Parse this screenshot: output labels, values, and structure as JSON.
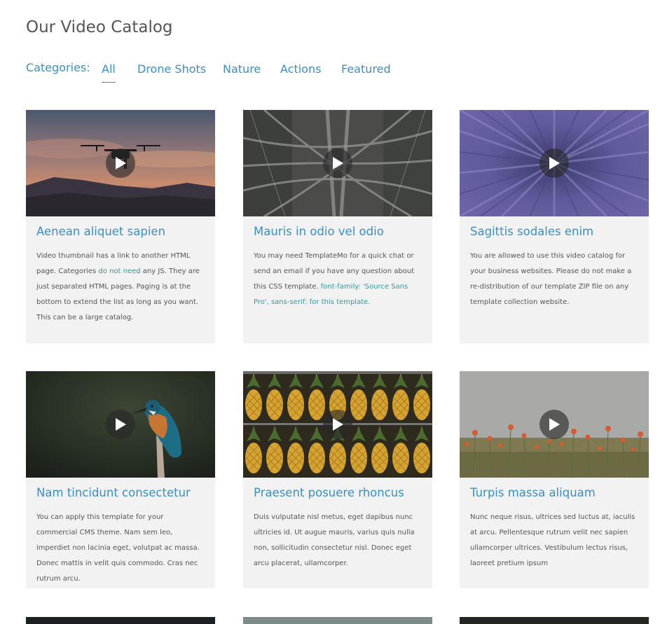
{
  "page": {
    "title": "Our Video Catalog"
  },
  "categories": {
    "label": "Categories:",
    "items": [
      {
        "label": "All",
        "active": true
      },
      {
        "label": "Drone Shots",
        "active": false
      },
      {
        "label": "Nature",
        "active": false
      },
      {
        "label": "Actions",
        "active": false
      },
      {
        "label": "Featured",
        "active": false
      }
    ]
  },
  "videos": [
    {
      "title": "Aenean aliquet sapien",
      "text_1": "Video thumbnail has a link to another HTML page. Categories ",
      "link": "do not need",
      "text_2": " any JS. They are just separated HTML pages. Paging is at the bottom to extend the list as long as you want. This can be a large catalog.",
      "thumbnail": "drone-at-sunset"
    },
    {
      "title": "Mauris in odio vel odio",
      "text_1": "You may need TemplateMo for a quick chat or send an email if you have any question about this CSS template. ",
      "link": "font-family: 'Source Sans Pro', sans-serif; for this template.",
      "text_2": "",
      "thumbnail": "highway-interchange"
    },
    {
      "title": "Sagittis sodales enim",
      "text_1": "You are allowed to use this video catalog for your business websites. Please do not make a re-distribution of our template ZIP file on any template collection website.",
      "link": "",
      "text_2": "",
      "thumbnail": "lavender-field"
    },
    {
      "title": "Nam tincidunt consectetur",
      "text_1": "You can apply this template for your commercial CMS theme. Nam sem leo, imperdiet non lacinia eget, volutpat ac massa. Donec mattis in velit quis commodo. Cras nec rutrum arcu.",
      "link": "",
      "text_2": "",
      "thumbnail": "kingfisher-bird"
    },
    {
      "title": "Praesent posuere rhoncus",
      "text_1": "Duis vulputate nisl metus, eget dapibus nunc ultricies id. Ut augue mauris, varius quis nulla non, sollicitudin consectetur nisl. Donec eget arcu placerat, ullamcorper.",
      "link": "",
      "text_2": "",
      "thumbnail": "pineapples-on-shelves"
    },
    {
      "title": "Turpis massa aliquam",
      "text_1": "Nunc neque risus, ultrices sed luctus at, iaculis at arcu. Pellentesque rutrum velit nec sapien ullamcorper ultrices. Vestibulum lectus risus, laoreet pretium ipsum",
      "link": "",
      "text_2": "",
      "thumbnail": "poppy-meadow"
    }
  ],
  "icons": {
    "play": "play-icon"
  },
  "colors": {
    "accent": "#3b8fc4",
    "link": "#2e9b9b",
    "card_bg": "#f2f2f2",
    "text": "#555555"
  }
}
